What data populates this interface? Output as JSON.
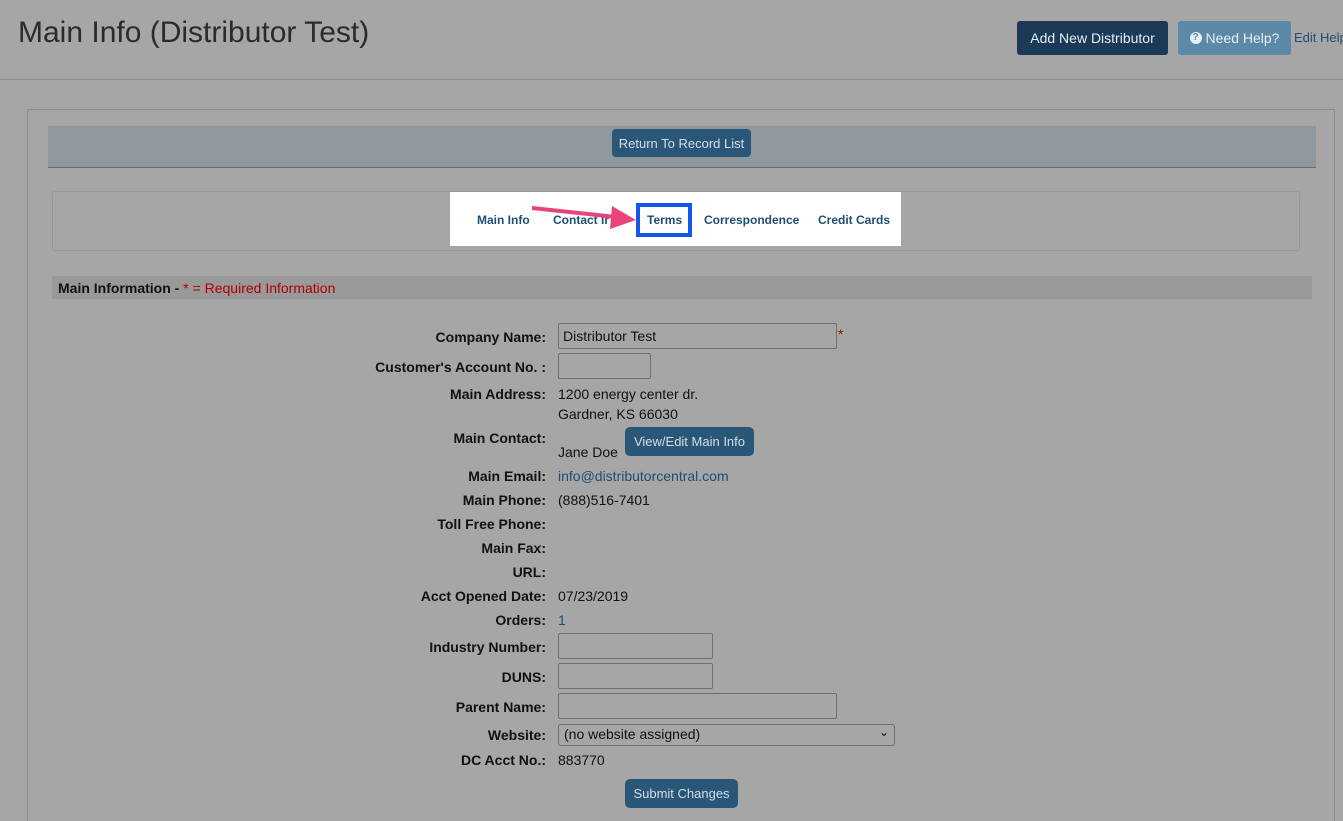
{
  "header": {
    "title": "Main Info (Distributor Test)",
    "add_button": "Add New Distributor",
    "help_button": "Need Help?",
    "help_icon": "question-circle-icon",
    "edit_help": "Edit Help"
  },
  "return_button": "Return To Record List",
  "tabs": {
    "main_info": "Main Info",
    "contact_info": "Contact Info",
    "terms": "Terms",
    "correspondence": "Correspondence",
    "credit_cards": "Credit Cards"
  },
  "annotation": {
    "arrow_color": "#e8437a",
    "highlight_color": "#1456ea"
  },
  "section": {
    "title": "Main Information - ",
    "required_note": "* = Required Information"
  },
  "form": {
    "company_name_label": "Company Name:",
    "company_name_value": "Distributor Test",
    "required_star": "*",
    "account_no_label": "Customer's Account No. :",
    "account_no_value": "",
    "main_address_label": "Main Address:",
    "address_line1": "1200 energy center dr.",
    "address_line2": "Gardner, KS 66030",
    "main_contact_label": "Main Contact:",
    "main_contact_value": "Jane Doe",
    "view_edit_button": "View/Edit Main Info",
    "main_email_label": "Main Email:",
    "main_email_value": "info@distributorcentral.com",
    "main_phone_label": "Main Phone:",
    "main_phone_value": "(888)516-7401",
    "toll_free_label": "Toll Free Phone:",
    "main_fax_label": "Main Fax:",
    "url_label": "URL:",
    "acct_opened_label": "Acct Opened Date:",
    "acct_opened_value": "07/23/2019",
    "orders_label": "Orders:",
    "orders_value": "1",
    "industry_label": "Industry Number:",
    "duns_label": "DUNS:",
    "parent_label": "Parent Name:",
    "website_label": "Website:",
    "website_value": "(no website assigned)",
    "dc_acct_label": "DC Acct No.:",
    "dc_acct_value": "883770",
    "submit_button": "Submit Changes"
  }
}
